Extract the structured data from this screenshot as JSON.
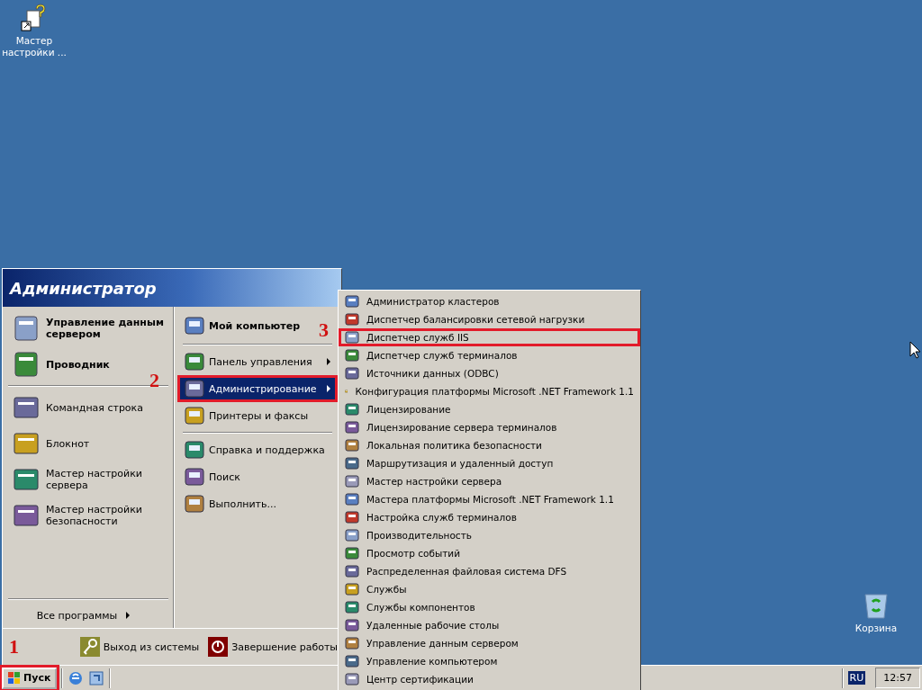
{
  "desktop_icons": [
    {
      "label": "Мастер настройки ..."
    },
    {
      "label": "Корзина"
    }
  ],
  "start_menu": {
    "user": "Администратор",
    "pinned": [
      {
        "label": "Управление данным сервером"
      },
      {
        "label": "Проводник"
      }
    ],
    "recent": [
      {
        "label": "Командная строка"
      },
      {
        "label": "Блокнот"
      },
      {
        "label": "Мастер настройки сервера"
      },
      {
        "label": "Мастер настройки безопасности"
      }
    ],
    "all_programs": "Все программы",
    "place_groups": [
      [
        {
          "label": "Мой компьютер",
          "bold": true,
          "arrow": false,
          "selected": false,
          "outlined": false
        }
      ],
      [
        {
          "label": "Панель управления",
          "bold": false,
          "arrow": true,
          "selected": false,
          "outlined": false
        },
        {
          "label": "Администрирование",
          "bold": false,
          "arrow": true,
          "selected": true,
          "outlined": true
        },
        {
          "label": "Принтеры и факсы",
          "bold": false,
          "arrow": false,
          "selected": false,
          "outlined": false
        }
      ],
      [
        {
          "label": "Справка и поддержка",
          "bold": false,
          "arrow": false,
          "selected": false,
          "outlined": false
        },
        {
          "label": "Поиск",
          "bold": false,
          "arrow": false,
          "selected": false,
          "outlined": false
        },
        {
          "label": "Выполнить...",
          "bold": false,
          "arrow": false,
          "selected": false,
          "outlined": false
        }
      ]
    ],
    "footer": [
      {
        "label": "Выход из системы"
      },
      {
        "label": "Завершение работы"
      }
    ]
  },
  "submenu": {
    "items": [
      {
        "label": "Администратор кластеров",
        "outlined": false
      },
      {
        "label": "Диспетчер балансировки сетевой нагрузки",
        "outlined": false
      },
      {
        "label": "Диспетчер служб IIS",
        "outlined": true
      },
      {
        "label": "Диспетчер служб терминалов",
        "outlined": false
      },
      {
        "label": "Источники данных (ODBC)",
        "outlined": false
      },
      {
        "label": "Конфигурация платформы Microsoft .NET Framework 1.1",
        "outlined": false
      },
      {
        "label": "Лицензирование",
        "outlined": false
      },
      {
        "label": "Лицензирование сервера терминалов",
        "outlined": false
      },
      {
        "label": "Локальная политика безопасности",
        "outlined": false
      },
      {
        "label": "Маршрутизация и удаленный доступ",
        "outlined": false
      },
      {
        "label": "Мастер настройки сервера",
        "outlined": false
      },
      {
        "label": "Мастера платформы Microsoft .NET Framework 1.1",
        "outlined": false
      },
      {
        "label": "Настройка служб терминалов",
        "outlined": false
      },
      {
        "label": "Производительность",
        "outlined": false
      },
      {
        "label": "Просмотр событий",
        "outlined": false
      },
      {
        "label": "Распределенная файловая система DFS",
        "outlined": false
      },
      {
        "label": "Службы",
        "outlined": false
      },
      {
        "label": "Службы компонентов",
        "outlined": false
      },
      {
        "label": "Удаленные рабочие столы",
        "outlined": false
      },
      {
        "label": "Управление данным сервером",
        "outlined": false
      },
      {
        "label": "Управление компьютером",
        "outlined": false
      },
      {
        "label": "Центр сертификации",
        "outlined": false
      }
    ]
  },
  "taskbar": {
    "start": {
      "label": "Пуск",
      "outlined": true
    },
    "language": "RU",
    "clock": "12:57"
  },
  "annotations": [
    {
      "number": "1"
    },
    {
      "number": "2"
    },
    {
      "number": "3"
    }
  ]
}
